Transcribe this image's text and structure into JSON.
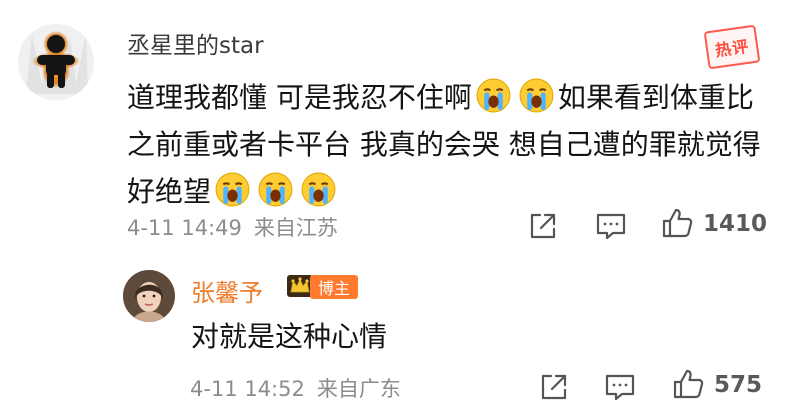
{
  "main_comment": {
    "username": "丞星里的star",
    "hot_badge": "热评",
    "text_segments": [
      "道理我都懂 可是我忍不住啊",
      "如果看到体重比之前重或者卡平台 我真的会哭 想自己遭的罪就觉得好绝望"
    ],
    "emoji_name": "crying-face-emoji",
    "timestamp": "4-11 14:49",
    "location": "来自江苏",
    "like_count": "1410"
  },
  "reply": {
    "username": "张馨予",
    "badge": "博主",
    "text": "对就是这种心情",
    "timestamp": "4-11 14:52",
    "location": "来自广东",
    "like_count": "575"
  },
  "icons": {
    "share": "share-icon",
    "comment": "comment-icon",
    "like": "thumbs-up-icon",
    "crown": "crown-icon"
  },
  "colors": {
    "username": "#3a3a3a",
    "meta": "#8c8c8c",
    "hot_badge": "#ff4c3b",
    "reply_name": "#ef7d2b",
    "blogger_badge": "#ff7a2e"
  }
}
